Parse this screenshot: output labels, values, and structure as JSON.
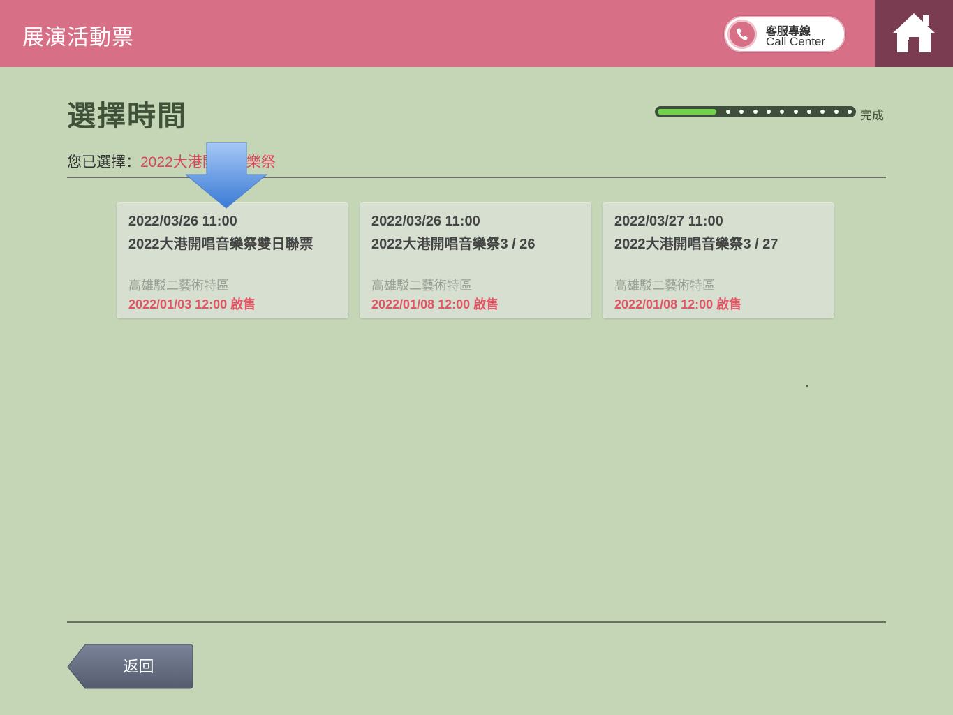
{
  "header": {
    "app_title": "展演活動票",
    "call_center": {
      "label_zh": "客服專線",
      "label_en": "Call Center",
      "icon": "phone-icon"
    },
    "home_icon": "home-icon"
  },
  "main": {
    "page_title": "選擇時間",
    "progress": {
      "label": "完成",
      "fraction": 0.3
    },
    "selected": {
      "label": "您已選擇：",
      "value": "2022大港開唱音樂祭"
    },
    "cards": [
      {
        "date": "2022/03/26 11:00",
        "name": "2022大港開唱音樂祭雙日聯票",
        "venue": "高雄駁二藝術特區",
        "sale": "2022/01/03 12:00 啟售"
      },
      {
        "date": "2022/03/26 11:00",
        "name": "2022大港開唱音樂祭3 / 26",
        "venue": "高雄駁二藝術特區",
        "sale": "2022/01/08 12:00 啟售"
      },
      {
        "date": "2022/03/27 11:00",
        "name": "2022大港開唱音樂祭3 / 27",
        "venue": "高雄駁二藝術特區",
        "sale": "2022/01/08 12:00 啟售"
      }
    ]
  },
  "footer": {
    "back_label": "返回"
  },
  "colors": {
    "header": "#d76f87",
    "home": "#7a3c50",
    "background": "#c5d6b6",
    "accent_red": "#e25566"
  }
}
